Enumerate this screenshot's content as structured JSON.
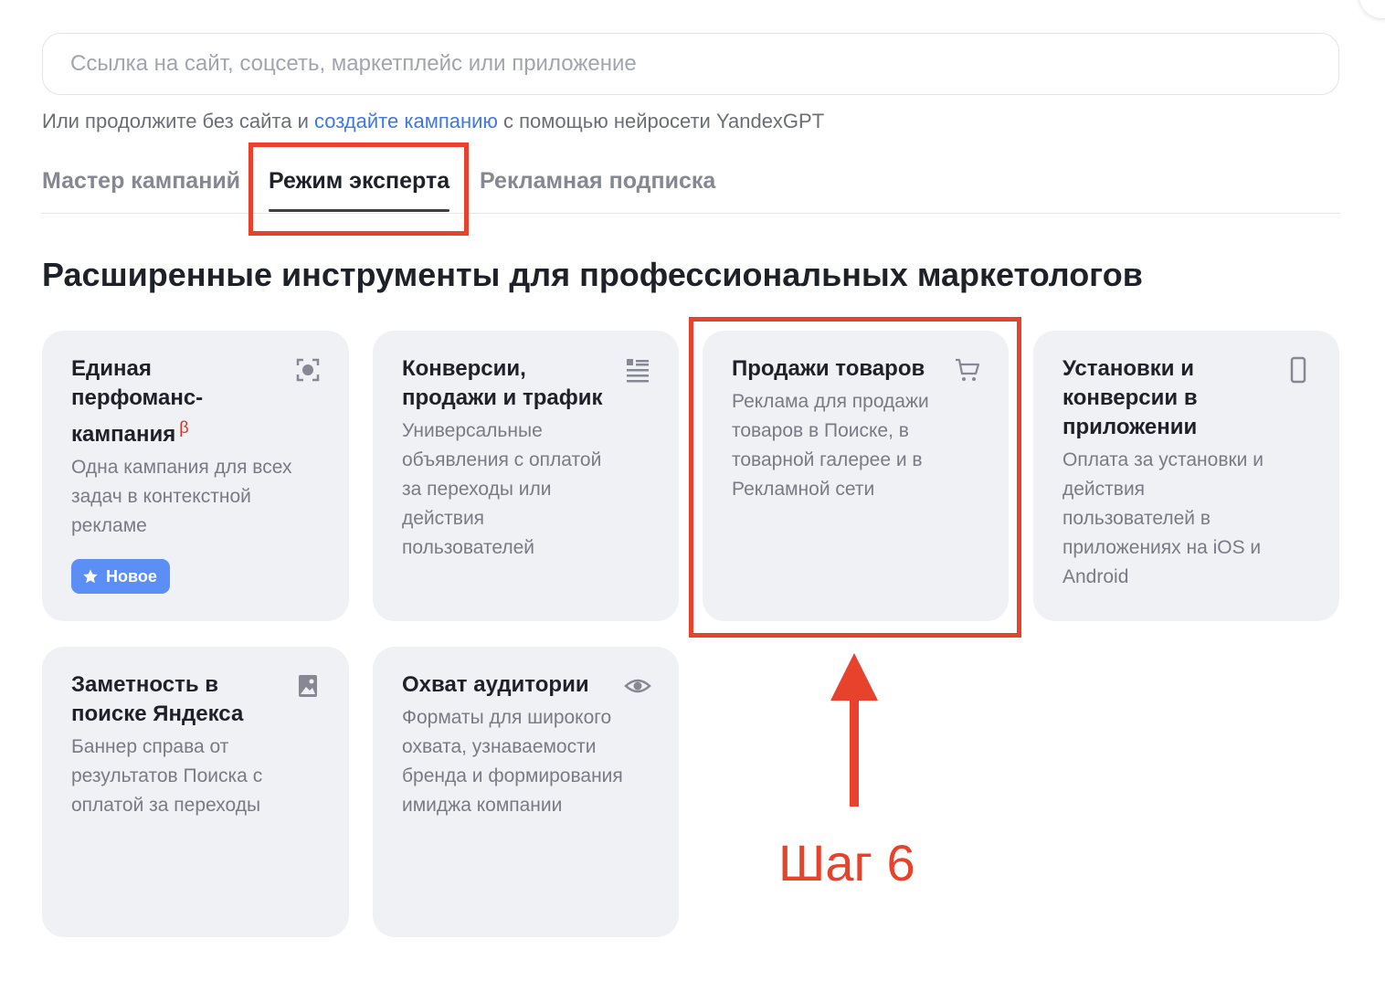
{
  "search": {
    "placeholder": "Ссылка на сайт, соцсеть, маркетплейс или приложение"
  },
  "hint": {
    "prefix": "Или продолжите без сайта и ",
    "link": "создайте кампанию",
    "suffix": " с помощью нейросети YandexGPT"
  },
  "tabs": [
    {
      "label": "Мастер кампаний",
      "active": false
    },
    {
      "label": "Режим эксперта",
      "active": true
    },
    {
      "label": "Рекламная подписка",
      "active": false
    }
  ],
  "page_title": "Расширенные инструменты для профессиональных маркетологов",
  "cards": [
    {
      "title": "Единая перфоманс-кампания",
      "beta": "β",
      "description": "Одна кампания для всех задач в контекстной рекламе",
      "icon": "target-icon",
      "badge": "Новое"
    },
    {
      "title": "Конверсии, продажи и трафик",
      "description": "Универсальные объявления с оплатой за переходы или действия пользователей",
      "icon": "list-icon"
    },
    {
      "title": "Продажи товаров",
      "description": "Реклама для продажи товаров в Поиске, в товарной галерее и в Рекламной сети",
      "icon": "cart-icon"
    },
    {
      "title": "Установки и конверсии в приложении",
      "description": "Оплата за установки и действия пользователей в приложениях на iOS и Android",
      "icon": "phone-icon"
    },
    {
      "title": "Заметность в поиске Яндекса",
      "description": "Баннер справа от результатов Поиска с оплатой за переходы",
      "icon": "image-icon"
    },
    {
      "title": "Охват аудитории",
      "description": "Форматы для широкого охвата, узнаваемости бренда и формирования имиджа компании",
      "icon": "eye-icon"
    }
  ],
  "annotation": {
    "step_label": "Шаг 6",
    "color": "#e8412c"
  },
  "colors": {
    "link": "#3e78e4",
    "card_bg": "#f0f1f4",
    "badge_bg": "#5b8ff5"
  }
}
